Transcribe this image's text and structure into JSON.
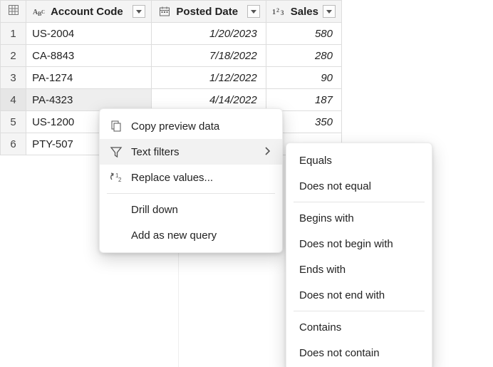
{
  "columns": {
    "account": {
      "label": "Account Code",
      "type_icon": "text-type-icon"
    },
    "date": {
      "label": "Posted Date",
      "type_icon": "date-type-icon"
    },
    "sales": {
      "label": "Sales",
      "type_icon": "number-type-icon"
    }
  },
  "rows": [
    {
      "n": "1",
      "account": "US-2004",
      "date": "1/20/2023",
      "sales": "580"
    },
    {
      "n": "2",
      "account": "CA-8843",
      "date": "7/18/2022",
      "sales": "280"
    },
    {
      "n": "3",
      "account": "PA-1274",
      "date": "1/12/2022",
      "sales": "90"
    },
    {
      "n": "4",
      "account": "PA-4323",
      "date": "4/14/2022",
      "sales": "187"
    },
    {
      "n": "5",
      "account": "US-1200",
      "date": "",
      "sales": "350"
    },
    {
      "n": "6",
      "account": "PTY-507",
      "date": "",
      "sales": ""
    }
  ],
  "context_menu": {
    "copy": "Copy preview data",
    "text_filters": "Text filters",
    "replace": "Replace values...",
    "drill": "Drill down",
    "add_query": "Add as new query"
  },
  "text_filters_submenu": {
    "equals": "Equals",
    "not_equal": "Does not equal",
    "begins": "Begins with",
    "not_begin": "Does not begin with",
    "ends": "Ends with",
    "not_end": "Does not end with",
    "contains": "Contains",
    "not_contain": "Does not contain"
  }
}
